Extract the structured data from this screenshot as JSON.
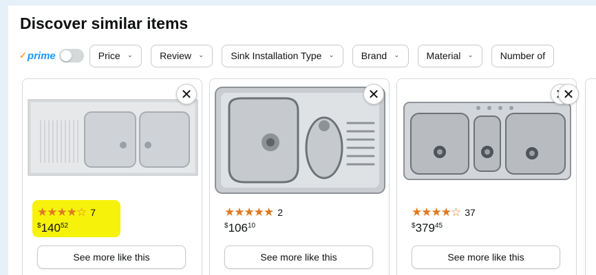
{
  "section": {
    "title": "Discover similar items"
  },
  "filters": {
    "prime_label": "prime",
    "chips": [
      {
        "label": "Price"
      },
      {
        "label": "Review"
      },
      {
        "label": "Sink Installation Type"
      },
      {
        "label": "Brand"
      },
      {
        "label": "Material"
      },
      {
        "label": "Number of"
      }
    ]
  },
  "products": [
    {
      "stars": "★★★★☆",
      "rating_count": "7",
      "price_symbol": "$",
      "price_whole": "140",
      "price_fraction": "52",
      "see_more_label": "See more like this",
      "highlighted": true
    },
    {
      "stars": "★★★★★",
      "rating_count": "2",
      "price_symbol": "$",
      "price_whole": "106",
      "price_fraction": "10",
      "see_more_label": "See more like this",
      "highlighted": false
    },
    {
      "stars": "★★★★☆",
      "rating_count": "37",
      "price_symbol": "$",
      "price_whole": "379",
      "price_fraction": "45",
      "see_more_label": "See more like this",
      "highlighted": false
    }
  ],
  "colors": {
    "star": "#de7921",
    "highlight": "#f7f20a",
    "prime": "#1a98ff"
  },
  "icons": {
    "close": "close-icon",
    "chevron": "chevron-down-icon"
  }
}
